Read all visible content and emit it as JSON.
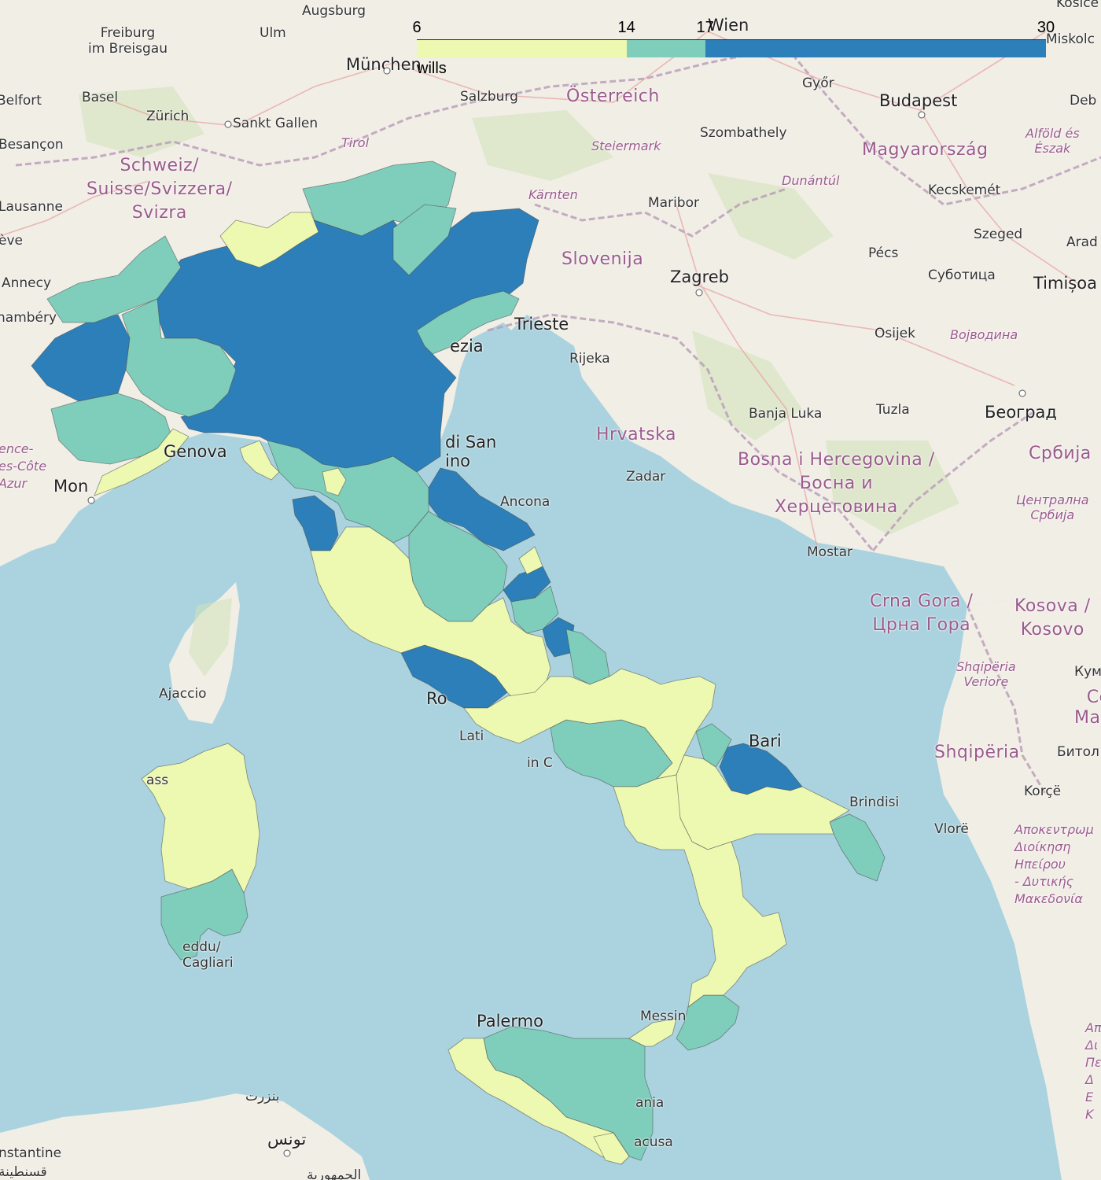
{
  "map": {
    "legend": {
      "title": "wills",
      "ticks": [
        "6",
        "14",
        "17",
        "30"
      ],
      "tick_values": [
        6,
        14,
        17,
        30
      ],
      "bins": [
        {
          "from": 6,
          "to": 14,
          "color": "#edf8b1"
        },
        {
          "from": 14,
          "to": 17,
          "color": "#7fcdbb"
        },
        {
          "from": 17,
          "to": 30,
          "color": "#2c7fb8"
        }
      ]
    },
    "colors": {
      "land": "#f2efe9",
      "sea": "#aad3df",
      "low": "#edf8b1",
      "mid": "#7fcdbb",
      "high": "#2c7fb8",
      "border": "#555555"
    },
    "place_labels": {
      "augsburg": "Augsburg",
      "wien": "Wien",
      "kosice": "Košice",
      "freiburg": "Freiburg\nim Breisgau",
      "ulm": "Ulm",
      "muenchen": "München",
      "miskolc": "Miskolc",
      "gyor": "Győr",
      "belfort": "Belfort",
      "basel": "Basel",
      "salzburg": "Salzburg",
      "oesterreich": "Österreich",
      "budapest": "Budapest",
      "debrecen": "Deb",
      "zuerich": "Zürich",
      "sankt_gallen": "Sankt Gallen",
      "szombathely": "Szombathely",
      "besancon": "Besançon",
      "tirol": "Tirol",
      "steiermark": "Steiermark",
      "magyarorszag": "Magyarország",
      "alfold": "Alföld és\nÉszak",
      "schweiz": "Schweiz/\nSuisse/Svizzera/\nSvizra",
      "dunantul": "Dunántúl",
      "lausanne": "Lausanne",
      "kaernten": "Kärnten",
      "maribor": "Maribor",
      "kecskemet": "Kecskemét",
      "szeged": "Szeged",
      "geneve": "ève",
      "slovenija": "Slovenija",
      "pecs": "Pécs",
      "arad": "Arad",
      "annecy": "Annecy",
      "zagreb": "Zagreb",
      "subotica": "Суботица",
      "timisoara": "Timișoa",
      "chambery": "hambéry",
      "trieste": "Trieste",
      "osijek": "Osijek",
      "vojvodina": "Војводина",
      "venezia": "ezia",
      "rijeka": "Rijeka",
      "banja_luka": "Banja Luka",
      "tuzla": "Tuzla",
      "beograd": "Београд",
      "san_marino": "di San\nino",
      "hrvatska": "Hrvatska",
      "genova": "Genova",
      "provence": "ence-\nes-Côte\nAzur",
      "bosna": "Bosna i Hercegovina /\nБосна и\nХерцеговина",
      "srbija": "Србија",
      "monaco": "Mon",
      "zadar": "Zadar",
      "ancona": "Ancona",
      "centralna_srbija": "Централна\nСрбија",
      "mostar": "Mostar",
      "crna_gora": "Crna Gora /\nЦрна Гора",
      "kosovo": "Kosova /\nKosovo",
      "shqiperia_veriore": "Shqipëria\nVeriore",
      "ajaccio": "Ajaccio",
      "roma": "Ro",
      "kumanovo": "Кум",
      "makedonija": "Се\nМаке",
      "latina": "Lati",
      "bari": "Bari",
      "shqiperia": "Shqipëria",
      "bitola": "Битол",
      "napoli": "in C",
      "sassari": "ass",
      "brindisi": "Brindisi",
      "korce": "Korçë",
      "vlore": "Vlorë",
      "ipeiros": "Αποκεντρωμ\nΔιοίκηση\nΗπείρου\n- Δυτικής\nΜακεδονία",
      "cagliari": "eddu/\nCagliari",
      "palermo": "Palermo",
      "messina": "Messin",
      "peloponnisos": "Αποκ\nΔι\nΠελο\nΔ\nΕ\nΚ",
      "bizerte": "بنزرت",
      "catania": "ania",
      "tunis": "تونس",
      "siracusa": "acusa",
      "constantine": "nstantine",
      "constantine_ar": "قسنطينة",
      "tunisia_bottom": "الجمهورية"
    }
  }
}
